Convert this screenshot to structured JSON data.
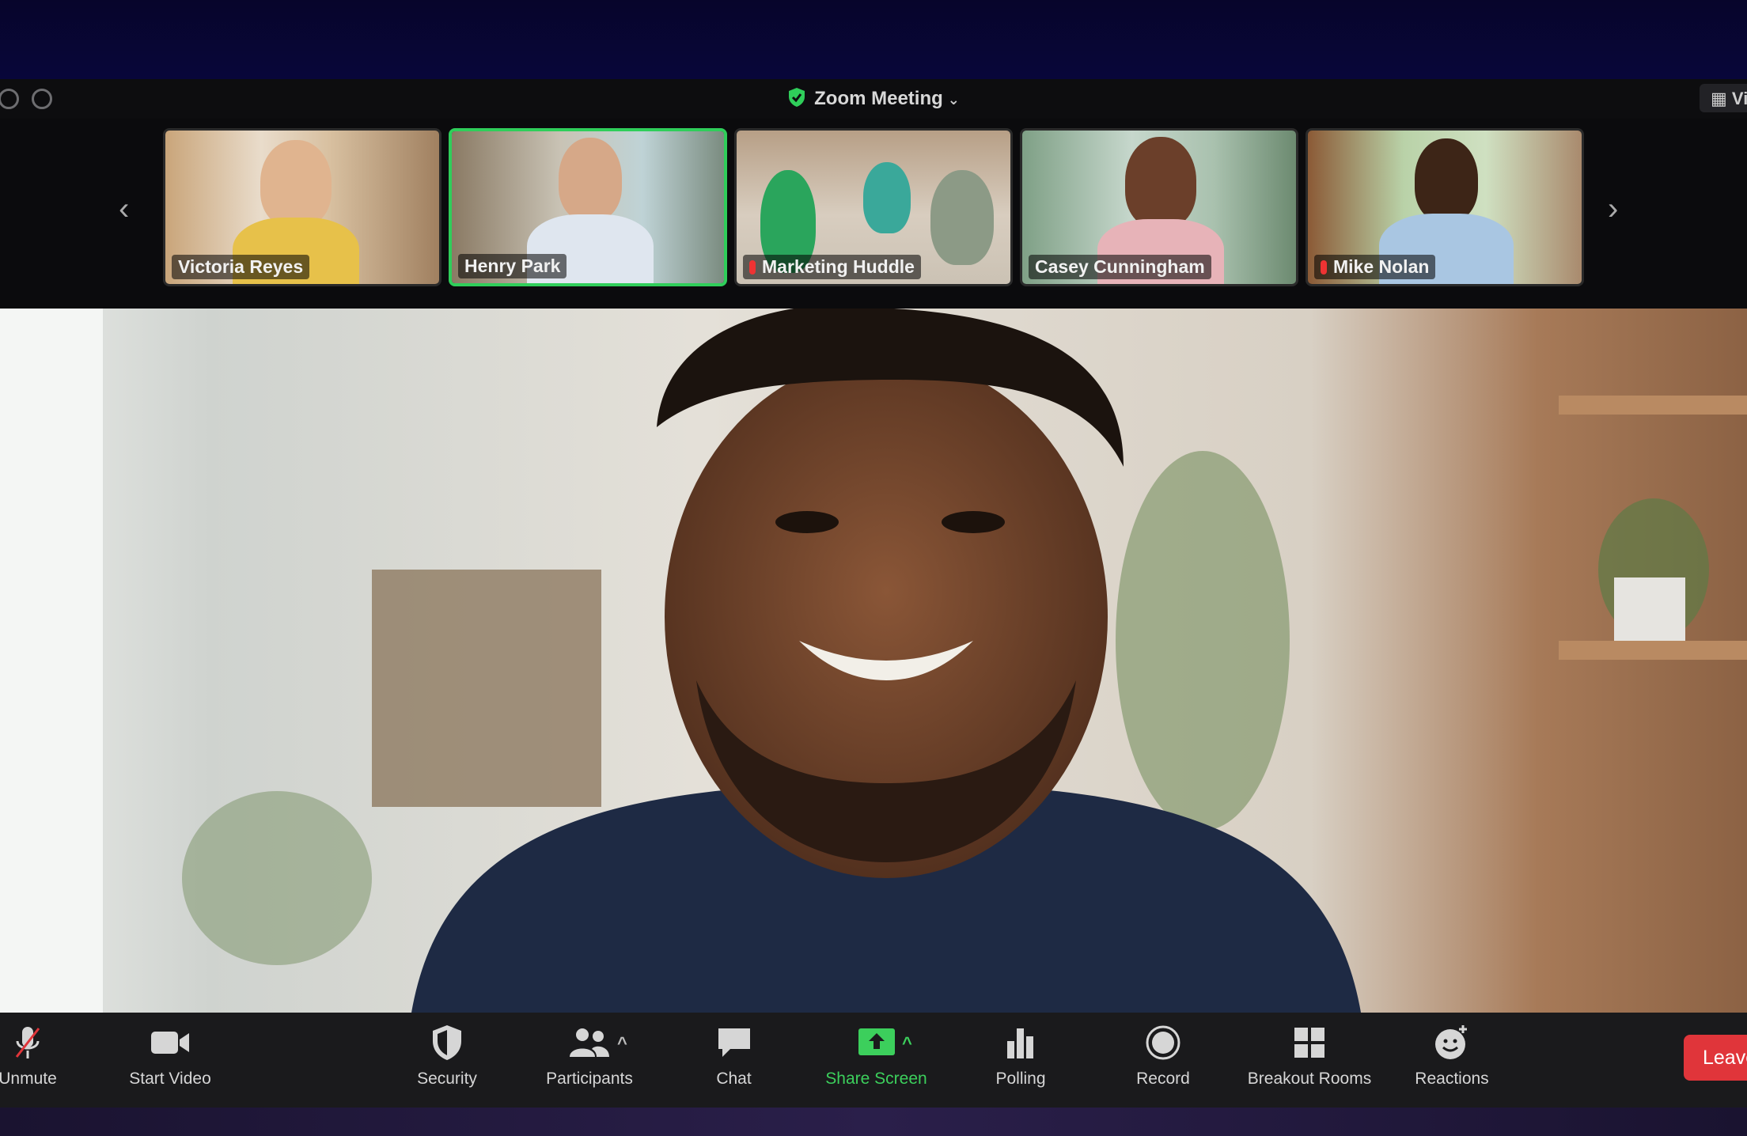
{
  "window": {
    "title": "Zoom Meeting",
    "view_label": "Vi"
  },
  "gallery": {
    "participants": [
      {
        "name": "Victoria Reyes",
        "muted": false,
        "active": false
      },
      {
        "name": "Henry Park",
        "muted": false,
        "active": true
      },
      {
        "name": "Marketing Huddle",
        "muted": true,
        "active": false
      },
      {
        "name": "Casey Cunningham",
        "muted": false,
        "active": false
      },
      {
        "name": "Mike Nolan",
        "muted": true,
        "active": false
      }
    ]
  },
  "toolbar": {
    "unmute": "Unmute",
    "start_video": "Start Video",
    "security": "Security",
    "participants": "Participants",
    "chat": "Chat",
    "share_screen": "Share Screen",
    "polling": "Polling",
    "record": "Record",
    "breakout_rooms": "Breakout Rooms",
    "reactions": "Reactions",
    "leave": "Leave"
  },
  "colors": {
    "accent_green": "#2fce5a",
    "leave_red": "#e0353a",
    "toolbar_bg": "#1a1a1c"
  }
}
